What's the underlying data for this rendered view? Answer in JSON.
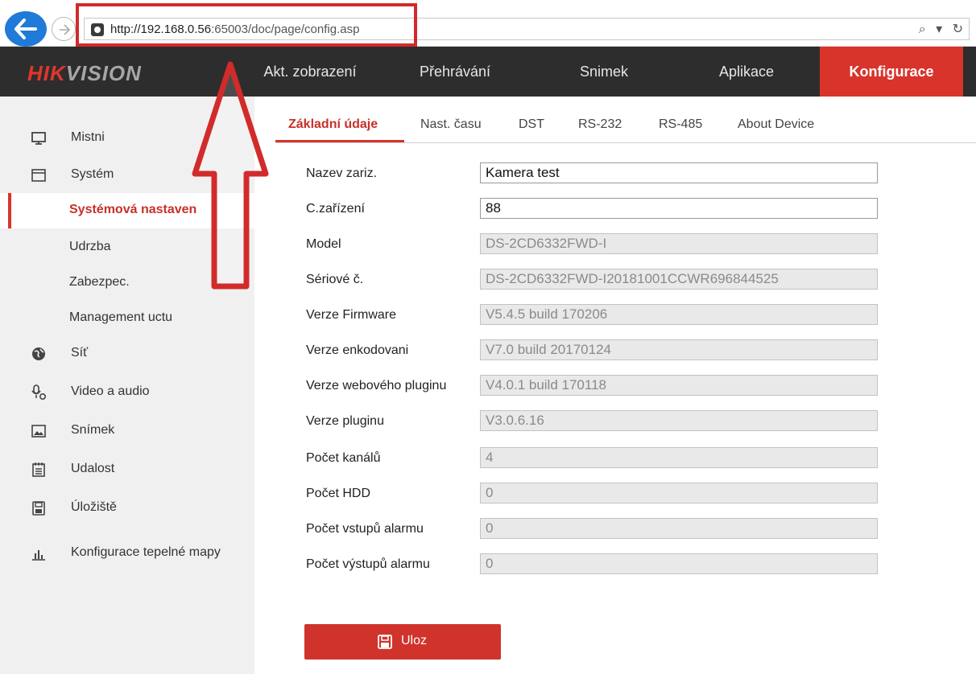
{
  "browser": {
    "url_host": "http://192.168.0.56",
    "url_rest": ":65003/doc/page/config.asp",
    "search_tools": "⌕ ▾ ↻"
  },
  "brand": {
    "logo_a": "HIK",
    "logo_b": "VISION"
  },
  "topnav": {
    "items": [
      "Akt. zobrazení",
      "Přehrávání",
      "Snimek",
      "Aplikace",
      "Konfigurace"
    ]
  },
  "sidebar": {
    "items": [
      {
        "label": "Mistni",
        "icon": "monitor-icon"
      },
      {
        "label": "Systém",
        "icon": "system-window-icon"
      },
      {
        "label": "Systémová nastaven",
        "selected": true
      },
      {
        "label": "Udrzba"
      },
      {
        "label": "Zabezpec."
      },
      {
        "label": "Management uctu"
      },
      {
        "label": "Síť",
        "icon": "globe-icon"
      },
      {
        "label": "Video a audio",
        "icon": "mic-icon"
      },
      {
        "label": "Snímek",
        "icon": "image-icon"
      },
      {
        "label": "Udalost",
        "icon": "calendar-icon"
      },
      {
        "label": "Úložiště",
        "icon": "storage-icon"
      },
      {
        "label": "Konfigurace tepelné mapy",
        "icon": "bar-chart-icon"
      }
    ]
  },
  "tabs": [
    "Základní údaje",
    "Nast. času",
    "DST",
    "RS-232",
    "RS-485",
    "About Device"
  ],
  "form": {
    "fields": [
      {
        "label": "Nazev zariz.",
        "value": "Kamera test",
        "readonly": false
      },
      {
        "label": "C.zařízení",
        "value": "88",
        "readonly": false
      },
      {
        "label": "Model",
        "value": "DS-2CD6332FWD-I",
        "readonly": true
      },
      {
        "label": "Sériové č.",
        "value": "DS-2CD6332FWD-I20181001CCWR696844525",
        "readonly": true
      },
      {
        "label": "Verze Firmware",
        "value": "V5.4.5 build 170206",
        "readonly": true
      },
      {
        "label": "Verze enkodovani",
        "value": "V7.0 build 20170124",
        "readonly": true
      },
      {
        "label": "Verze webového pluginu",
        "value": "V4.0.1 build 170118",
        "readonly": true
      },
      {
        "label": "Verze pluginu",
        "value": "V3.0.6.16",
        "readonly": true
      },
      {
        "label": "Počet kanálů",
        "value": "4",
        "readonly": true
      },
      {
        "label": "Počet HDD",
        "value": "0",
        "readonly": true
      },
      {
        "label": "Počet vstupů alarmu",
        "value": "0",
        "readonly": true
      },
      {
        "label": "Počet výstupů alarmu",
        "value": "0",
        "readonly": true
      }
    ],
    "save_label": "Uloz"
  },
  "colors": {
    "accent": "#d8342b",
    "nav_bg": "#2d2d2d",
    "sidebar_bg": "#f0f0f0",
    "annotation": "#d12b2b"
  }
}
